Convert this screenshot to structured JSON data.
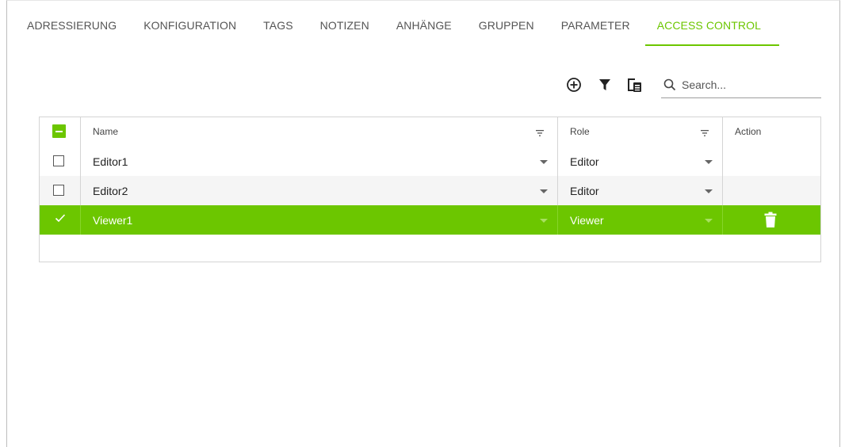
{
  "tabs": [
    {
      "label": "ADRESSIERUNG",
      "active": false
    },
    {
      "label": "KONFIGURATION",
      "active": false
    },
    {
      "label": "TAGS",
      "active": false
    },
    {
      "label": "NOTIZEN",
      "active": false
    },
    {
      "label": "ANHÄNGE",
      "active": false
    },
    {
      "label": "GRUPPEN",
      "active": false
    },
    {
      "label": "PARAMETER",
      "active": false
    },
    {
      "label": "ACCESS CONTROL",
      "active": true
    }
  ],
  "toolbar": {
    "icons": [
      "add-circle-icon",
      "filter-icon",
      "column-chooser-icon"
    ]
  },
  "search": {
    "placeholder": "Search..."
  },
  "grid": {
    "columns": {
      "name": "Name",
      "role": "Role",
      "action": "Action"
    },
    "rows": [
      {
        "name": "Editor1",
        "role": "Editor",
        "selected": false
      },
      {
        "name": "Editor2",
        "role": "Editor",
        "selected": false
      },
      {
        "name": "Viewer1",
        "role": "Viewer",
        "selected": true
      }
    ]
  },
  "colors": {
    "accent": "#6cc600",
    "row_alt": "#f5f5f5"
  }
}
